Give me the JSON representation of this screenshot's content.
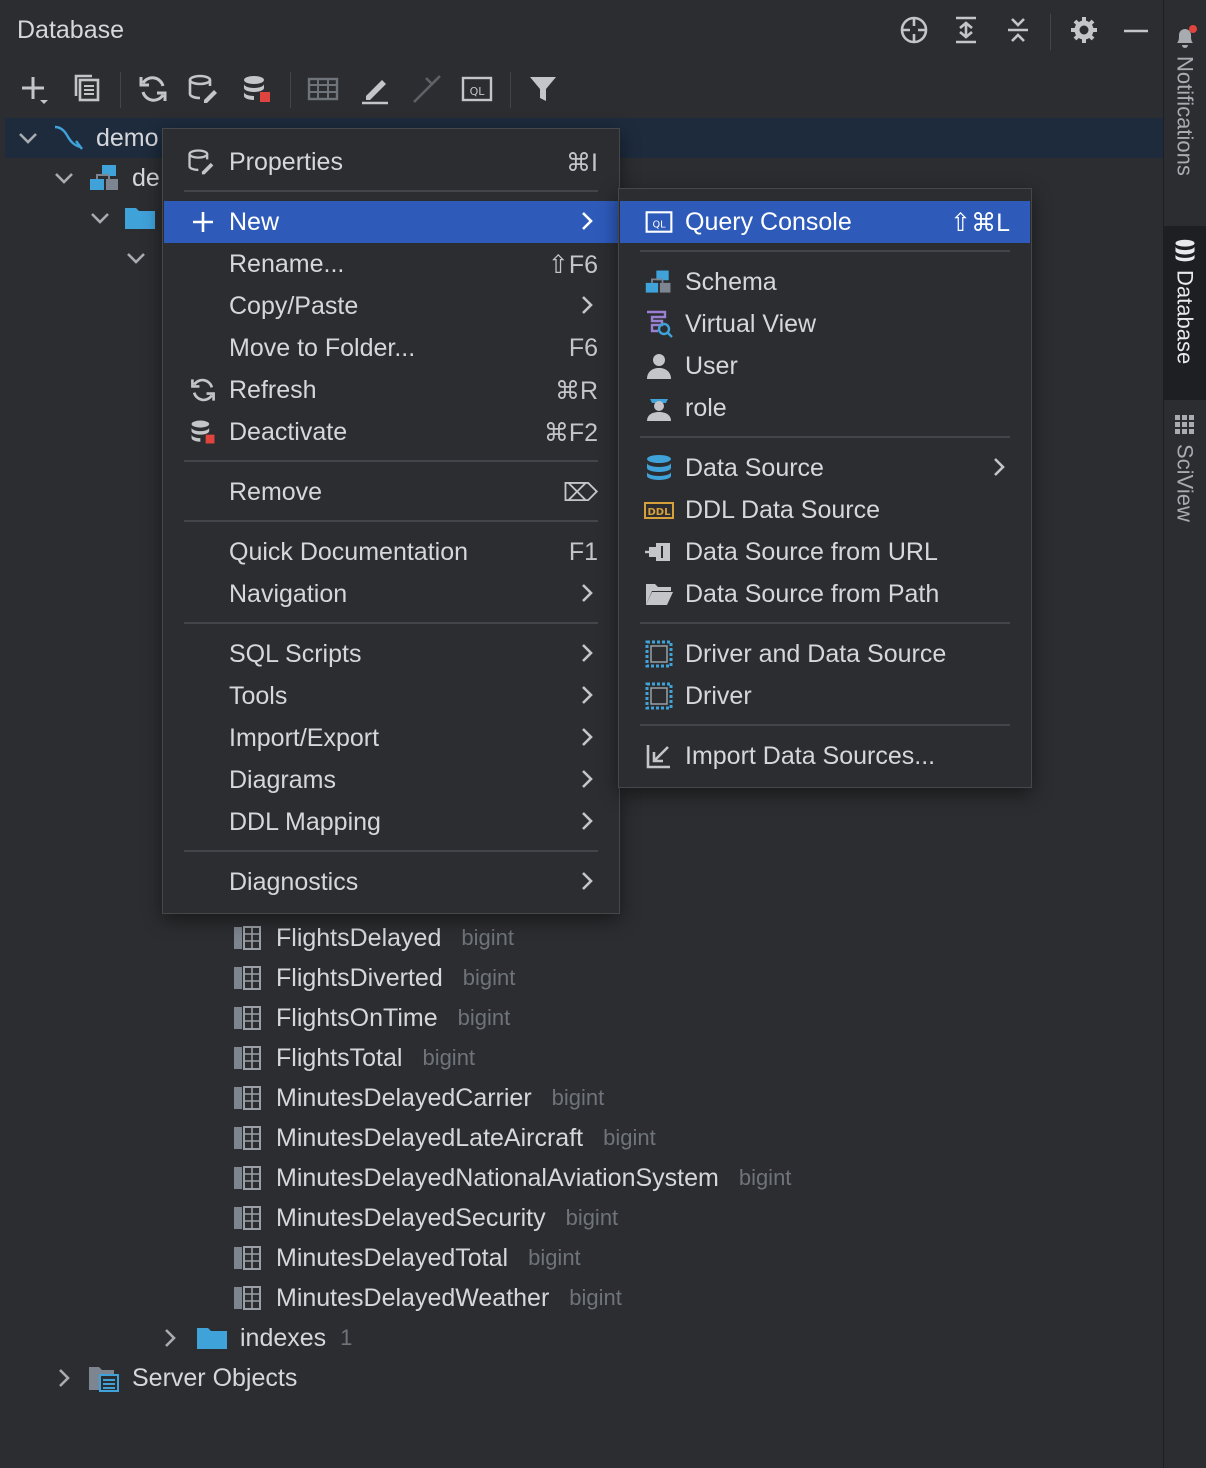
{
  "panel": {
    "title": "Database"
  },
  "tree": {
    "root_label": "demo",
    "schema_label": "de",
    "columns": [
      {
        "name": "FlightsDelayed",
        "type": "bigint"
      },
      {
        "name": "FlightsDiverted",
        "type": "bigint"
      },
      {
        "name": "FlightsOnTime",
        "type": "bigint"
      },
      {
        "name": "FlightsTotal",
        "type": "bigint"
      },
      {
        "name": "MinutesDelayedCarrier",
        "type": "bigint"
      },
      {
        "name": "MinutesDelayedLateAircraft",
        "type": "bigint"
      },
      {
        "name": "MinutesDelayedNationalAviationSystem",
        "type": "bigint"
      },
      {
        "name": "MinutesDelayedSecurity",
        "type": "bigint"
      },
      {
        "name": "MinutesDelayedTotal",
        "type": "bigint"
      },
      {
        "name": "MinutesDelayedWeather",
        "type": "bigint"
      }
    ],
    "indexes_label": "indexes",
    "indexes_count": "1",
    "server_objects_label": "Server Objects"
  },
  "context_menu": {
    "properties": {
      "label": "Properties",
      "shortcut": "⌘I"
    },
    "new": {
      "label": "New"
    },
    "rename": {
      "label": "Rename...",
      "shortcut": "⇧F6"
    },
    "copy_paste": {
      "label": "Copy/Paste"
    },
    "move_to_folder": {
      "label": "Move to Folder...",
      "shortcut": "F6"
    },
    "refresh": {
      "label": "Refresh",
      "shortcut": "⌘R"
    },
    "deactivate": {
      "label": "Deactivate",
      "shortcut": "⌘F2"
    },
    "remove": {
      "label": "Remove",
      "shortcut": "⌦"
    },
    "quick_documentation": {
      "label": "Quick Documentation",
      "shortcut": "F1"
    },
    "navigation": {
      "label": "Navigation"
    },
    "sql_scripts": {
      "label": "SQL Scripts"
    },
    "tools": {
      "label": "Tools"
    },
    "import_export": {
      "label": "Import/Export"
    },
    "diagrams": {
      "label": "Diagrams"
    },
    "ddl_mapping": {
      "label": "DDL Mapping"
    },
    "diagnostics": {
      "label": "Diagnostics"
    }
  },
  "new_submenu": {
    "query_console": {
      "label": "Query Console",
      "shortcut": "⇧⌘L"
    },
    "schema": {
      "label": "Schema"
    },
    "virtual_view": {
      "label": "Virtual View"
    },
    "user": {
      "label": "User"
    },
    "role": {
      "label": "role"
    },
    "data_source": {
      "label": "Data Source"
    },
    "ddl_data_source": {
      "label": "DDL Data Source"
    },
    "data_source_url": {
      "label": "Data Source from URL"
    },
    "data_source_path": {
      "label": "Data Source from Path"
    },
    "driver_and_data_source": {
      "label": "Driver and Data Source"
    },
    "driver": {
      "label": "Driver"
    },
    "import_data_sources": {
      "label": "Import Data Sources..."
    }
  },
  "right_strip": {
    "notifications": "Notifications",
    "database": "Database",
    "sciview": "SciView"
  },
  "colors": {
    "background": "#2b2d30",
    "highlight": "#2e5ab9",
    "selected_row": "#1d2b3d",
    "text": "#d6d7da",
    "muted": "#6f737a",
    "accent_blue": "#3fa2d9"
  }
}
